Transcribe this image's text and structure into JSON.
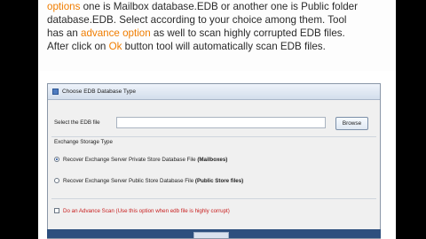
{
  "caption": {
    "line1": {
      "highlight": "options",
      "rest": " one is Mailbox database.EDB or another one is Public folder"
    },
    "line2": "database.EDB. Select according to your choice among them. Tool",
    "line3": {
      "pre": "has an ",
      "highlight": "advance option",
      "post": " as well to scan highly corrupted EDB files."
    },
    "line4": {
      "pre": "After click on ",
      "highlight": "Ok",
      "post": " button tool will automatically scan EDB files."
    }
  },
  "dialog": {
    "title": "Choose EDB Database Type",
    "select_label": "Select the EDB file",
    "file_value": "",
    "browse_label": "Browse",
    "group_label": "Exchange Storage Type",
    "option1": {
      "text": "Recover Exchange Server Private Store Database File ",
      "bold": "(Mailboxes)",
      "selected": true
    },
    "option2": {
      "text": "Recover Exchange Server Public Store Database File ",
      "bold": "(Public Store files)",
      "selected": false
    },
    "advance_scan": {
      "text": "Do an Advance Scan (Use this option when edb file is highly corrupt)",
      "checked": false
    }
  },
  "colors": {
    "highlight": "#f07d00",
    "warning_text": "#c81e1e",
    "footer_bar": "#2d4f7e"
  },
  "icons": {
    "title_icon": "window-app-icon"
  }
}
